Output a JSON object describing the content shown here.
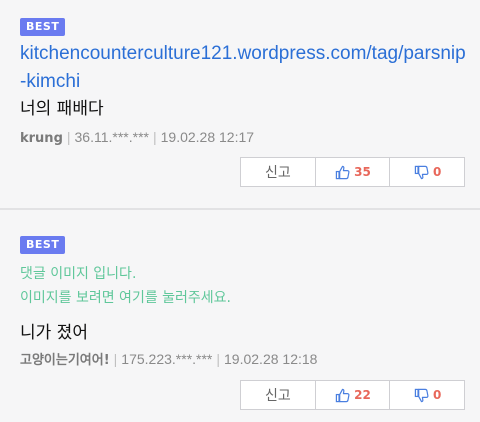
{
  "colors": {
    "best_badge": "#6a7bf0",
    "link": "#2b6fd6",
    "placeholder": "#5fc79a",
    "count": "#e8675a",
    "thumb_up_icon": "#4a7fe0",
    "thumb_down_icon": "#4a7fe0"
  },
  "comments": [
    {
      "badge": "BEST",
      "link": "kitchencounterculture121.wordpress.com/tag/parsnip-kimchi",
      "text": "너의 패배다",
      "author": "krung",
      "ip": "36.11.***.***",
      "date": "19.02.28 12:17",
      "report_label": "신고",
      "up_count": "35",
      "down_count": "0",
      "up_icon": "thumb-up-icon",
      "down_icon": "thumb-down-icon"
    },
    {
      "badge": "BEST",
      "image_placeholder_line1": "댓글 이미지 입니다.",
      "image_placeholder_line2": "이미지를 보려면 여기를 눌러주세요.",
      "text": "니가 졌어",
      "author": "고양이는기여어!",
      "ip": "175.223.***.***",
      "date": "19.02.28 12:18",
      "report_label": "신고",
      "up_count": "22",
      "down_count": "0",
      "up_icon": "thumb-up-icon",
      "down_icon": "thumb-down-icon"
    }
  ]
}
